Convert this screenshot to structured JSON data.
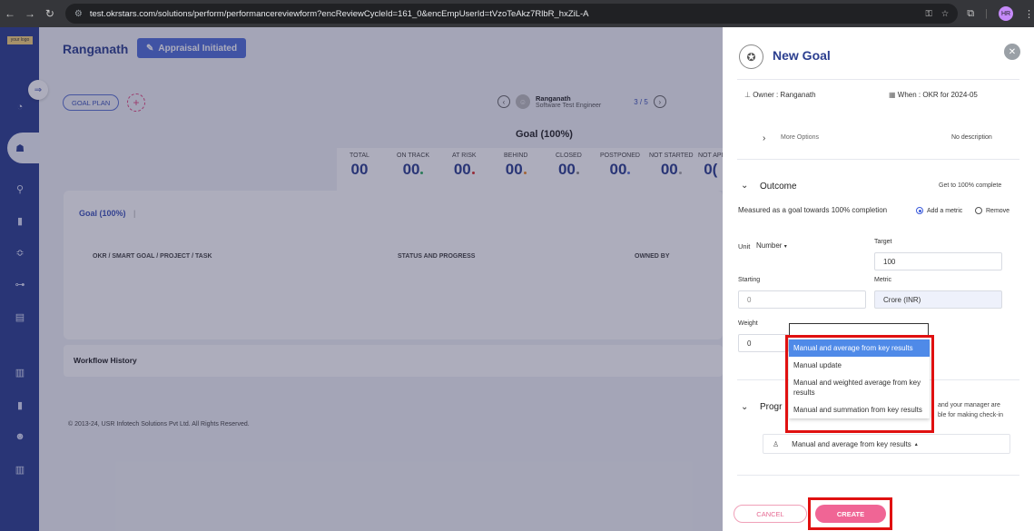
{
  "browser": {
    "url": "test.okrstars.com/solutions/perform/performancereviewform?encReviewCycleId=161_0&encEmpUserId=tVzoTeAkz7RlbR_hxZiL-A",
    "profile_initials": "HR"
  },
  "sidebar": {
    "logo": "your logo"
  },
  "header": {
    "title": "Ranganath",
    "badge": "Appraisal Initiated"
  },
  "toolbar": {
    "goal_plan": "GOAL PLAN",
    "add": "+"
  },
  "user_nav": {
    "name": "Ranganath",
    "role": "Software Test Engineer",
    "pager": "3 / 5"
  },
  "goal_summary": {
    "heading": "Goal (100%)",
    "stats": [
      {
        "label": "TOTAL",
        "value": "00",
        "dot": ""
      },
      {
        "label": "ON TRACK",
        "value": "00",
        "dot": "#2eae5f"
      },
      {
        "label": "AT RISK",
        "value": "00",
        "dot": "#d9302c"
      },
      {
        "label": "BEHIND",
        "value": "00",
        "dot": "#f08c2a"
      },
      {
        "label": "CLOSED",
        "value": "00",
        "dot": "#888888"
      },
      {
        "label": "POSTPONED",
        "value": "00",
        "dot": "#5a72d0"
      },
      {
        "label": "NOT STARTED",
        "value": "00",
        "dot": "#aaaaaa"
      },
      {
        "label": "NOT API",
        "value": "0(",
        "dot": ""
      }
    ]
  },
  "goal_table": {
    "tab": "Goal (100%)",
    "columns": [
      "OKR / SMART GOAL / PROJECT / TASK",
      "STATUS AND PROGRESS",
      "OWNED BY"
    ]
  },
  "workflow": {
    "title": "Workflow History"
  },
  "footer": {
    "copyright": "© 2013-24, USR Infotech Solutions Pvt Ltd. All Rights Reserved."
  },
  "panel": {
    "title": "New Goal",
    "owner": "Owner : Ranganath",
    "when": "When : OKR for 2024-05",
    "more_options": "More Options",
    "no_description": "No description",
    "outcome": {
      "title": "Outcome",
      "hint": "Get to 100% complete",
      "measured": "Measured as a goal towards 100% completion",
      "add_metric": "Add a metric",
      "remove": "Remove",
      "unit_label": "Unit",
      "unit_value": "Number",
      "target_label": "Target",
      "target_value": "100",
      "starting_label": "Starting",
      "starting_value": "0",
      "metric_label": "Metric",
      "metric_value": "Crore (INR)",
      "weight_label": "Weight",
      "weight_value": "0"
    },
    "dropdown_options": [
      "Manual and average from key results",
      "Manual update",
      "Manual and weighted average from key results",
      "Manual and summation from key results"
    ],
    "progress": {
      "title": "Progr",
      "hint_line1": "and your manager are",
      "hint_line2": "ble for making check-in",
      "selected": "Manual and average from key results"
    },
    "cancel": "CANCEL",
    "create": "CREATE"
  }
}
